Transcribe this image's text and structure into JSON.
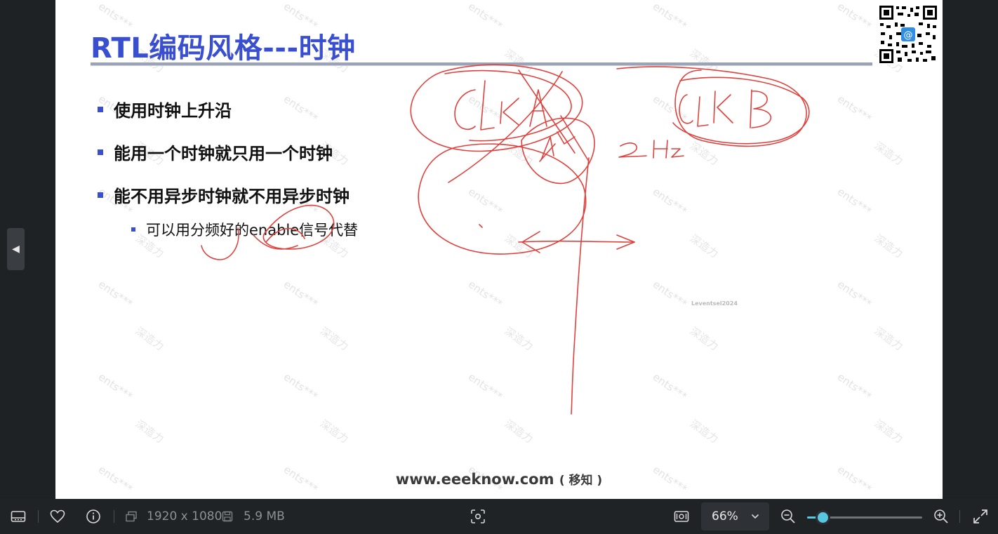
{
  "slide": {
    "title": "RTL编码风格---时钟",
    "bullets": [
      "使用时钟上升沿",
      "能用一个时钟就只用一个时钟",
      "能不用异步时钟就不用异步时钟"
    ],
    "sub_bullet": "可以用分频好的enable信号代替",
    "footer_site": "www.eeeknow.com",
    "footer_paren": "( 移知 )",
    "watermark_text_a": "ents***",
    "watermark_text_b": "深造力",
    "watermark_user": "Leventsel2024",
    "colors": {
      "title": "#3a4fd0",
      "ink": "#e0413c",
      "bullet_marker": "#3a4fd0"
    }
  },
  "viewer": {
    "nav_prev_icon": "triangle-left-icon",
    "toolbar": {
      "left_icons": [
        "filmstrip-icon",
        "heart-icon",
        "info-icon"
      ],
      "resolution": "1920 x 1080",
      "file_size": "5.9 MB",
      "zoom_percent": "66%",
      "zoom_fraction": 0.14,
      "accent": "#58c8e0"
    }
  }
}
